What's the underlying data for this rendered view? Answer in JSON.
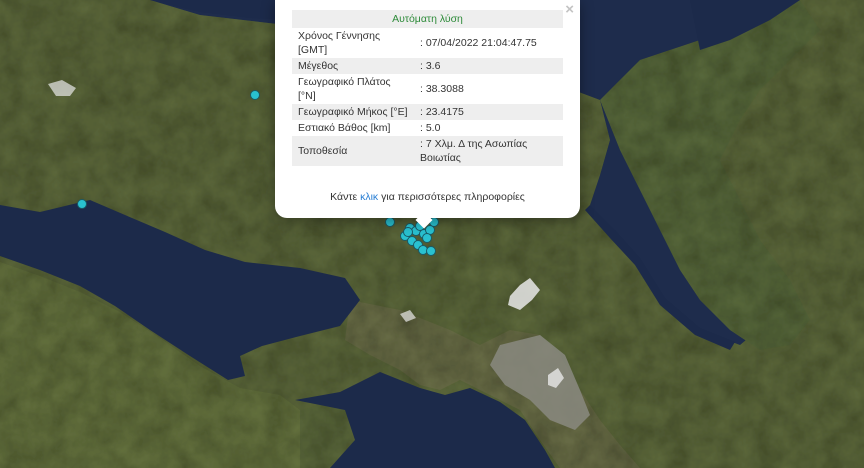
{
  "popup": {
    "title": "Αυτόματη λύση",
    "close_icon": "×",
    "rows": [
      {
        "label": "Χρόνος Γέννησης [GMT]",
        "value": ": 07/04/2022 21:04:47.75"
      },
      {
        "label": "Μέγεθος",
        "value": ": 3.6"
      },
      {
        "label": "Γεωγραφικό Πλάτος [°N]",
        "value": ": 38.3088"
      },
      {
        "label": "Γεωγραφικό Μήκος [°E]",
        "value": ": 23.4175"
      },
      {
        "label": "Εστιακό Βάθος [km]",
        "value": ": 5.0"
      },
      {
        "label": "Τοποθεσία",
        "value": ": 7 Χλμ. Δ της Ασωπίας Βοιωτίας"
      }
    ],
    "more_prefix": "Κάντε ",
    "more_link": "κλικ",
    "more_suffix": " για περισσότερες πληροφορίες"
  },
  "colors": {
    "marker": "#29c1d0",
    "title_green": "#2e8b3a",
    "link_blue": "#2a7fd4",
    "sea": "#1e2c4c"
  }
}
